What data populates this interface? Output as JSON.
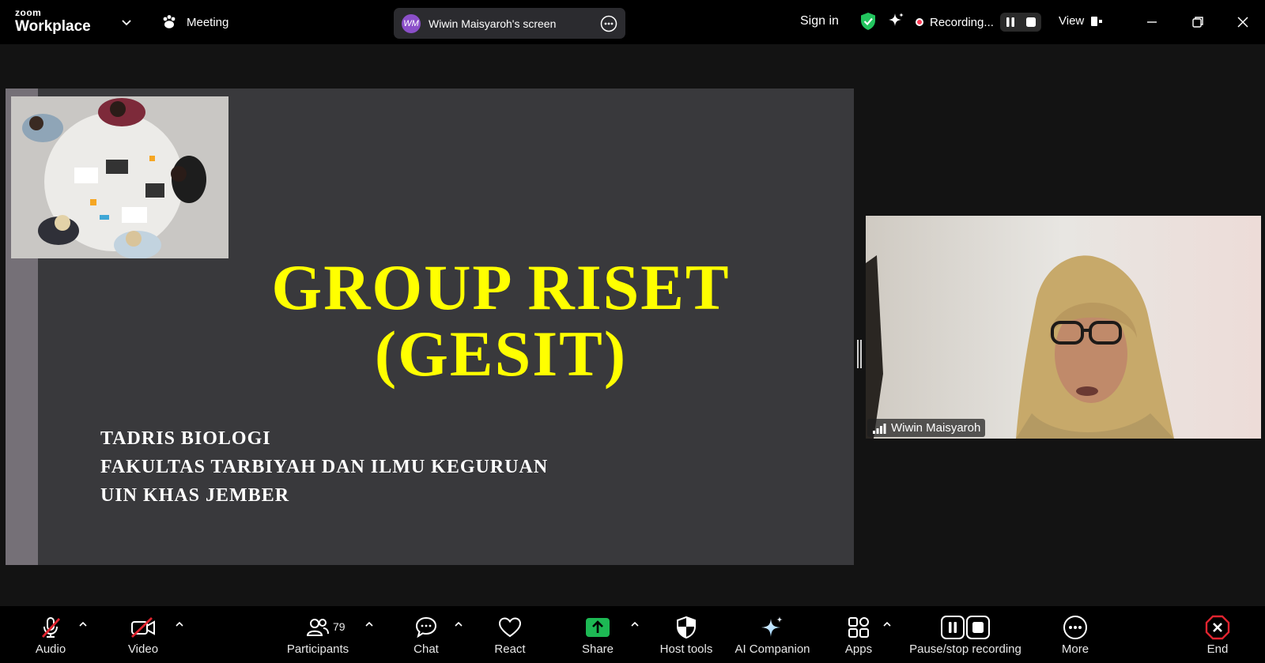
{
  "topbar": {
    "brand_small": "zoom",
    "brand_large": "Workplace",
    "meeting_label": "Meeting",
    "share_initials": "WM",
    "share_title": "Wiwin Maisyaroh's screen",
    "sign_in": "Sign in",
    "recording_label": "Recording...",
    "view_label": "View"
  },
  "slide": {
    "title_line1": "GROUP RISET",
    "title_line2": "(GESIT)",
    "sub_line1": "TADRIS BIOLOGI",
    "sub_line2": "FAKULTAS TARBIYAH DAN ILMU KEGURUAN",
    "sub_line3": "UIN KHAS JEMBER"
  },
  "video": {
    "participant_name": "Wiwin Maisyaroh"
  },
  "toolbar": {
    "audio": "Audio",
    "video": "Video",
    "participants": "Participants",
    "participant_count": "79",
    "chat": "Chat",
    "react": "React",
    "share": "Share",
    "host_tools": "Host tools",
    "ai_companion": "AI Companion",
    "apps": "Apps",
    "pause_stop": "Pause/stop recording",
    "more": "More",
    "end": "End"
  },
  "colors": {
    "slide_title": "#ffff00",
    "slide_bg": "#39393c",
    "share_green": "#1db954",
    "shield_green": "#22c55e",
    "end_red": "#e0242f",
    "muted_red": "#e0242f"
  }
}
